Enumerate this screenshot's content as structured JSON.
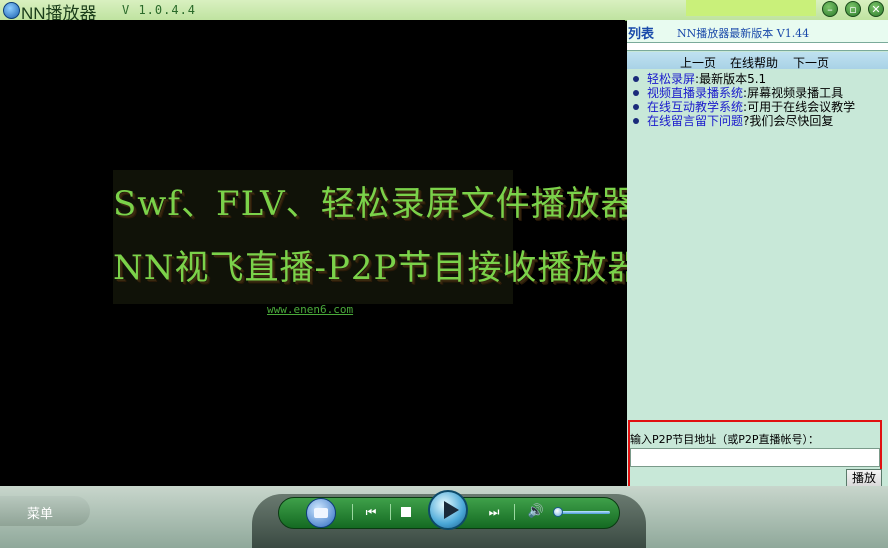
{
  "window": {
    "title": "NN播放器",
    "version": "V 1.0.4.4",
    "minimize_glyph": "–",
    "restore_glyph": "▫",
    "close_glyph": "✕"
  },
  "video": {
    "banner_line1": "Swf、FLV、轻松录屏文件播放器",
    "banner_line2": "NN视飞直播-P2P节目接收播放器",
    "site_link": "www.enen6.com"
  },
  "panel": {
    "list_label": "列表",
    "latest_version": "NN播放器最新版本 V1.44",
    "nav": {
      "prev": "上一页",
      "help": "在线帮助",
      "next": "下一页"
    },
    "items": [
      {
        "link": "轻松录屏",
        "sep": ":",
        "text": "最新版本5.1"
      },
      {
        "link": "视频直播录播系统",
        "sep": ":",
        "text": "屏幕视频录播工具"
      },
      {
        "link": "在线互动教学系统",
        "sep": ":",
        "text": "可用于在线会议教学"
      },
      {
        "link": "在线留言留下问题",
        "sep": "?",
        "text": "我们会尽快回复"
      }
    ]
  },
  "p2p": {
    "label": "输入P2P节目地址（或P2P直播帐号）：",
    "input_value": "",
    "play_label": "播放"
  },
  "controls": {
    "menu_label": "菜单",
    "prev_glyph": "⏮",
    "next_glyph": "⏭",
    "volume_glyph": "🔊",
    "volume_level": 0.05
  },
  "colors": {
    "accent": "#2a8a3a",
    "link": "#1a1acc",
    "highlight_border": "#e01010"
  }
}
